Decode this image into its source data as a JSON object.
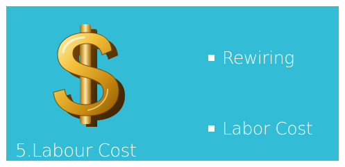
{
  "slide": {
    "background_color": "#33bcd6",
    "image": {
      "icon": "dollar-sign-icon",
      "color": "#e2a21c"
    },
    "caption": "5.Labour Cost",
    "bullets": [
      {
        "label": "Rewiring"
      },
      {
        "label": "Labor Cost"
      }
    ]
  }
}
